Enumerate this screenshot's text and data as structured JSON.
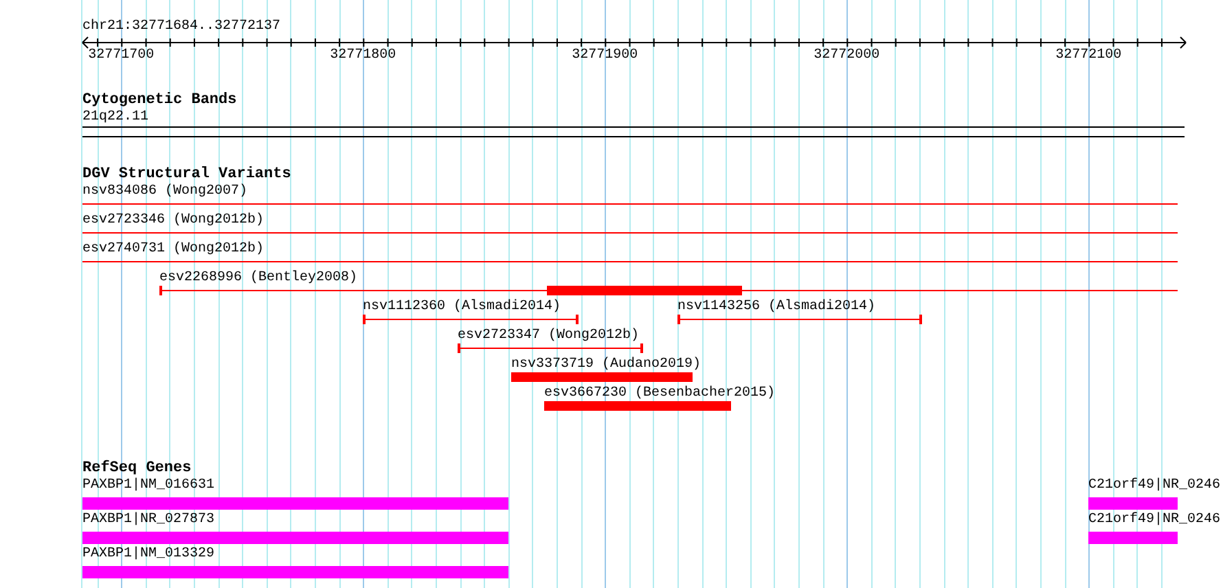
{
  "locus": "chr21:32771684..32772137",
  "ruler": {
    "labels": [
      "32771700",
      "32771800",
      "32771900",
      "32772000",
      "32772100"
    ]
  },
  "tracks": [
    {
      "title": "Cytogenetic Bands",
      "kind": "bands",
      "rows": [
        [
          {
            "label": "21q22.11",
            "kind": "band"
          }
        ]
      ]
    },
    {
      "title": "DGV Structural Variants",
      "kind": "variants",
      "rows": [
        [
          {
            "label": "nsv834086 (Wong2007)",
            "kind": "line"
          }
        ],
        [
          {
            "label": "esv2723346 (Wong2012b)",
            "kind": "line"
          }
        ],
        [
          {
            "label": "esv2740731 (Wong2012b)",
            "kind": "line"
          }
        ],
        [
          {
            "label": "esv2268996 (Bentley2008)",
            "kind": "line"
          }
        ],
        [
          {
            "label": "nsv1112360 (Alsmadi2014)",
            "kind": "line"
          },
          {
            "label": "nsv1143256 (Alsmadi2014)",
            "kind": "line"
          }
        ],
        [
          {
            "label": "esv2723347 (Wong2012b)",
            "kind": "line"
          }
        ],
        [
          {
            "label": "nsv3373719 (Audano2019)",
            "kind": "bar"
          }
        ],
        [
          {
            "label": "esv3667230 (Besenbacher2015)",
            "kind": "bar"
          }
        ]
      ]
    },
    {
      "title": "RefSeq Genes",
      "kind": "genes",
      "rows": [
        [
          {
            "label": "PAXBP1|NM_016631",
            "kind": "gene"
          },
          {
            "label": "C21orf49|NR_0246",
            "kind": "gene"
          }
        ],
        [
          {
            "label": "PAXBP1|NR_027873",
            "kind": "gene"
          },
          {
            "label": "C21orf49|NR_0246",
            "kind": "gene"
          }
        ],
        [
          {
            "label": "PAXBP1|NM_013329",
            "kind": "gene"
          }
        ]
      ]
    }
  ]
}
